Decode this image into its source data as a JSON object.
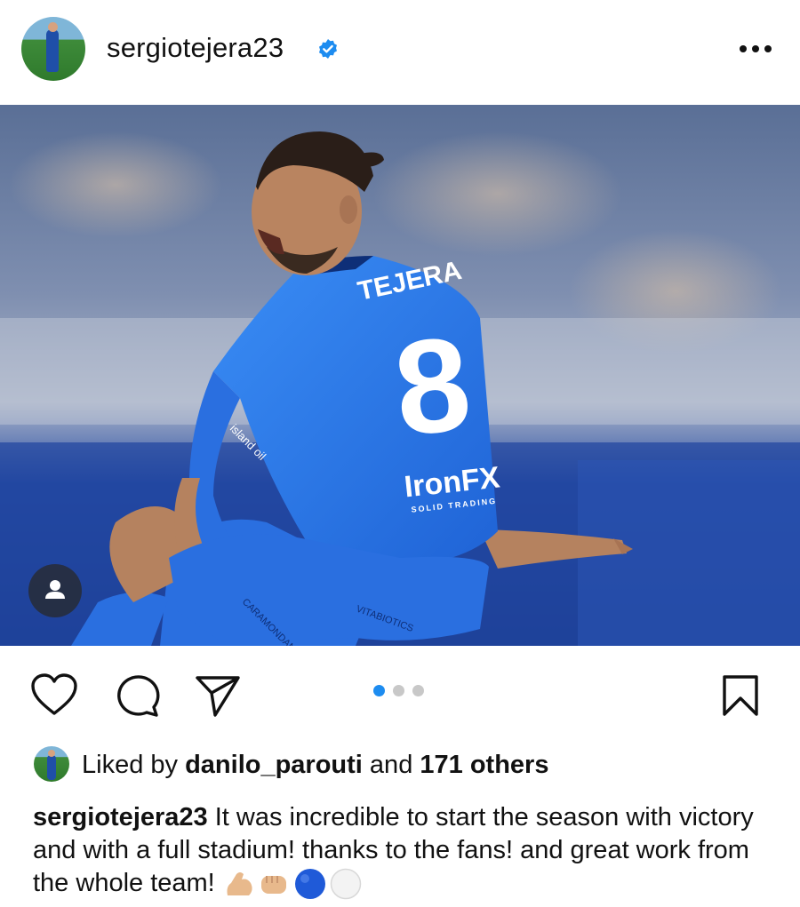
{
  "header": {
    "username": "sergiotejera23",
    "verified_icon": "verified-badge-icon",
    "more_icon": "more-options-icon"
  },
  "photo": {
    "jersey_name": "TEJERA",
    "jersey_number": "8",
    "sponsor": "IronFX",
    "sponsor_tagline": "SOLID TRADING",
    "sleeve_brand": "island oil",
    "shorts_text": "CARAMONDANI",
    "shorts_text2": "VITABIOTICS"
  },
  "actions": {
    "like_icon": "heart-icon",
    "comment_icon": "comment-icon",
    "share_icon": "share-icon",
    "save_icon": "bookmark-icon",
    "carousel_total": 3,
    "carousel_active": 1,
    "active_color": "#1d8cf0"
  },
  "likes": {
    "prefix": "Liked by ",
    "user": "danilo_parouti",
    "middle": " and ",
    "others": "171 others"
  },
  "caption": {
    "username": "sergiotejera23",
    "text": " It was incredible to start the season with victory and with a full stadium! thanks to the fans! and great work from the whole team! ",
    "emojis": [
      "flexed-biceps",
      "fist-bump",
      "blue-circle",
      "white-circle"
    ]
  }
}
